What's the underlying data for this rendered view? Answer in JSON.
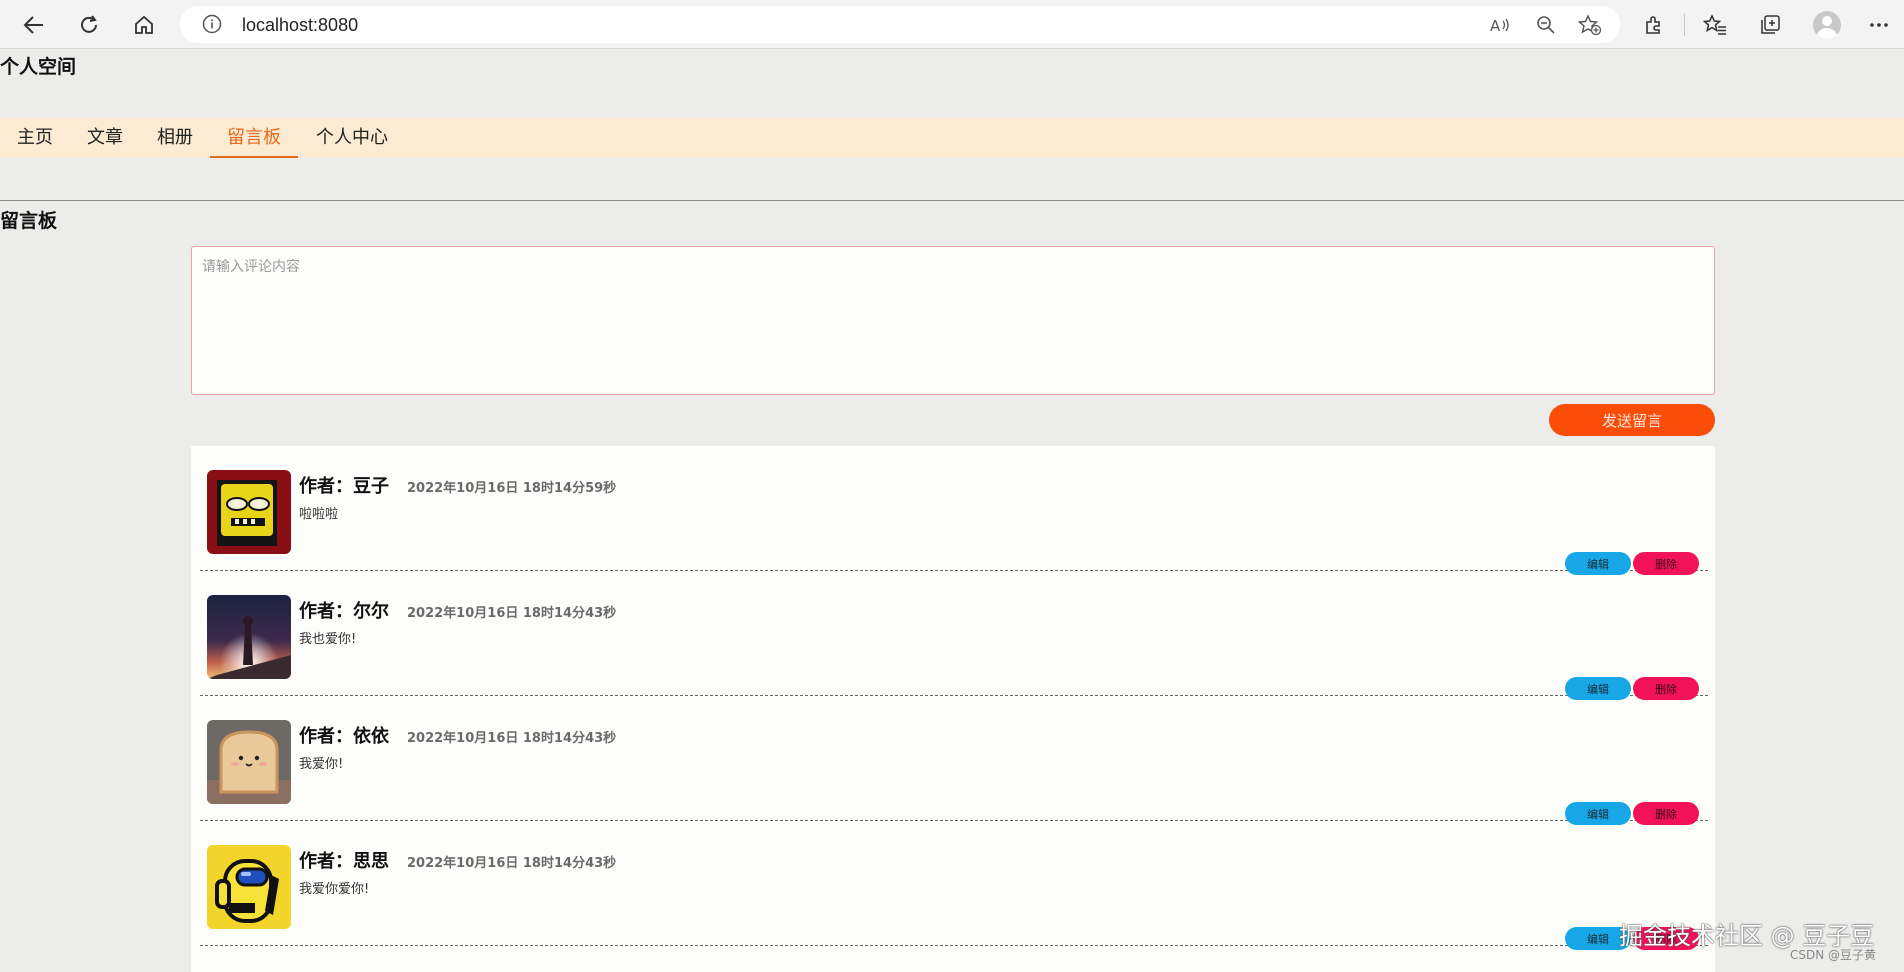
{
  "browser": {
    "url": "localhost:8080",
    "icons": [
      "back-icon",
      "refresh-icon",
      "home-icon",
      "info-icon",
      "read-aloud-icon",
      "zoom-out-icon",
      "add-favorite-icon",
      "extensions-icon",
      "favorites-icon",
      "collections-icon",
      "profile-icon",
      "more-icon"
    ]
  },
  "site": {
    "title": "个人空间"
  },
  "nav": {
    "items": [
      {
        "label": "主页"
      },
      {
        "label": "文章"
      },
      {
        "label": "相册"
      },
      {
        "label": "留言板"
      },
      {
        "label": "个人中心"
      }
    ],
    "active": "留言板",
    "active_color": "#e46a1c",
    "bar_color": "#fbebd3"
  },
  "board": {
    "title": "留言板",
    "input_placeholder": "请输入评论内容",
    "send_label": "发送留言",
    "send_color": "#fb4d0a"
  },
  "messages": [
    {
      "author": "作者：豆子",
      "time": "2022年10月16日 18时14分59秒",
      "text": "啦啦啦",
      "edit_label": "编辑",
      "delete_label": "删除"
    },
    {
      "author": "作者：尔尔",
      "time": "2022年10月16日 18时14分43秒",
      "text": "我也爱你!",
      "edit_label": "编辑",
      "delete_label": "删除"
    },
    {
      "author": "作者：依依",
      "time": "2022年10月16日 18时14分43秒",
      "text": "我爱你!",
      "edit_label": "编辑",
      "delete_label": "删除"
    },
    {
      "author": "作者：思思",
      "time": "2022年10月16日 18时14分43秒",
      "text": "我爱你爱你!",
      "edit_label": "编辑",
      "delete_label": "删除"
    }
  ],
  "watermark": {
    "main": "掘金技术社区 @ 豆子豆",
    "small": "CSDN @豆子黄"
  }
}
